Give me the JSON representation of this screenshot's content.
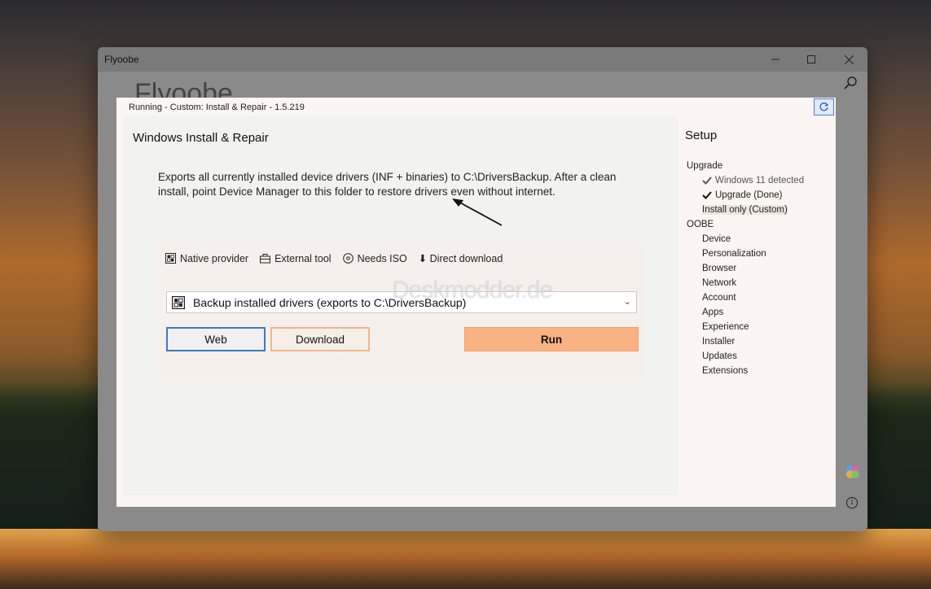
{
  "window": {
    "title": "Flyoobe",
    "background_heading": "Flyoobe"
  },
  "dialog": {
    "status": "Running - Custom: Install & Repair - 1.5.219",
    "panel_title": "Windows Install & Repair",
    "description": "Exports all currently installed device drivers (INF + binaries) to C:\\DriversBackup. After a clean install, point Device Manager to this folder to restore drivers even without internet.",
    "legend": {
      "native": "Native provider",
      "external": "External tool",
      "iso": "Needs ISO",
      "direct": "⬇ Direct download"
    },
    "select_value": "Backup installed drivers (exports to C:\\DriversBackup)",
    "buttons": {
      "web": "Web",
      "download": "Download",
      "run": "Run"
    },
    "watermark": "Deskmodder.de"
  },
  "sidebar": {
    "title": "Setup",
    "upgrade": "Upgrade",
    "upgrade_items": [
      "Windows 11 detected",
      "Upgrade (Done)",
      "Install only (Custom)"
    ],
    "oobe": "OOBE",
    "oobe_items": [
      "Device",
      "Personalization",
      "Browser",
      "Network",
      "Account",
      "Apps",
      "Experience",
      "Installer",
      "Updates",
      "Extensions"
    ]
  },
  "colors": {
    "accent_blue": "#3d79c9",
    "run_orange": "#f9b283"
  }
}
